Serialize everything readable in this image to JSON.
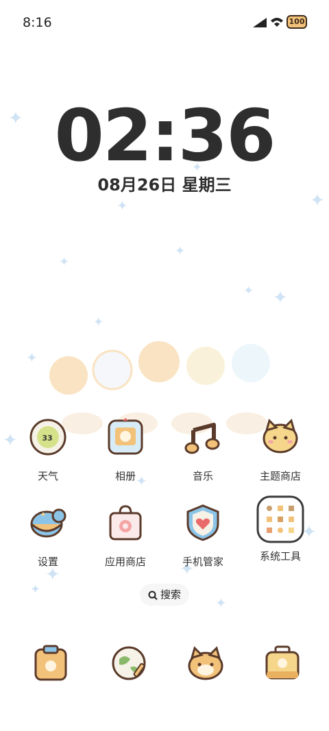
{
  "status_bar": {
    "time": "8:16",
    "battery": "100"
  },
  "lockscreen": {
    "clock": "02:36",
    "date": "08月26日 星期三"
  },
  "apps": [
    {
      "label": "天气",
      "icon": "weather-icon",
      "badge": "33"
    },
    {
      "label": "相册",
      "icon": "gallery-icon"
    },
    {
      "label": "音乐",
      "icon": "music-icon"
    },
    {
      "label": "主题商店",
      "icon": "theme-store-icon"
    },
    {
      "label": "设置",
      "icon": "settings-icon"
    },
    {
      "label": "应用商店",
      "icon": "app-store-icon"
    },
    {
      "label": "手机管家",
      "icon": "phone-manager-icon"
    },
    {
      "label": "系统工具",
      "icon": "system-tools-folder-icon"
    }
  ],
  "search": {
    "label": "搜索"
  },
  "dock": [
    {
      "icon": "dock-clipboard-icon"
    },
    {
      "icon": "dock-browser-icon"
    },
    {
      "icon": "dock-cat-icon"
    },
    {
      "icon": "dock-briefcase-icon"
    }
  ],
  "colors": {
    "text": "#2e2e2e",
    "sparkle": "#cfe3f5",
    "accent": "#f3c27a"
  }
}
